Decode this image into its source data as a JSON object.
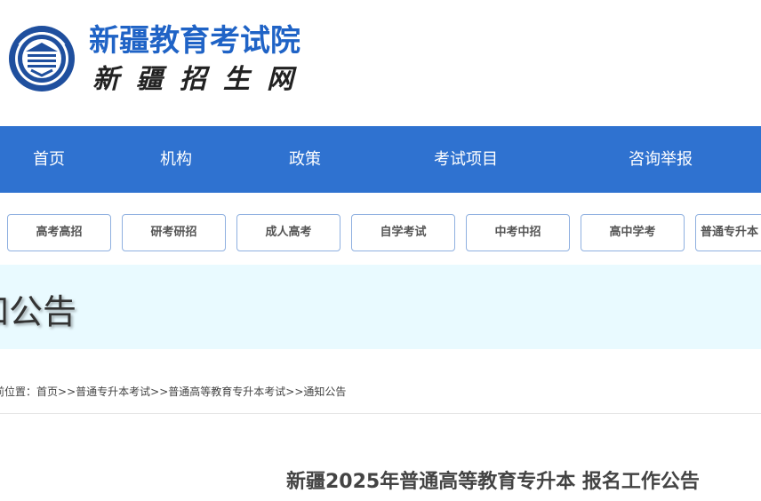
{
  "header": {
    "site_title": "新疆教育考试院",
    "site_subtitle": "新疆招生网"
  },
  "nav": {
    "items": [
      {
        "label": "首页"
      },
      {
        "label": "机构"
      },
      {
        "label": "政策"
      },
      {
        "label": "考试项目"
      },
      {
        "label": "咨询举报"
      }
    ]
  },
  "subnav": {
    "items": [
      {
        "label": "高考高招"
      },
      {
        "label": "研考研招"
      },
      {
        "label": "成人高考"
      },
      {
        "label": "自学考试"
      },
      {
        "label": "中考中招"
      },
      {
        "label": "高中学考"
      },
      {
        "label": "普通专升本"
      }
    ]
  },
  "banner": {
    "title": "知公告"
  },
  "breadcrumb": {
    "prefix": "前位置：",
    "items": [
      {
        "label": "首页"
      },
      {
        "label": "普通专升本考试"
      },
      {
        "label": "普通高等教育专升本考试"
      },
      {
        "label": "通知公告"
      }
    ],
    "separator": ">>"
  },
  "article": {
    "title": "新疆2025年普通高等教育专升本 报名工作公告"
  },
  "colors": {
    "brand_blue": "#2f72d0",
    "title_blue": "#1f63c6",
    "banner_bg": "#e9faff"
  },
  "icons": {
    "logo": "exam-institute-emblem-icon"
  }
}
